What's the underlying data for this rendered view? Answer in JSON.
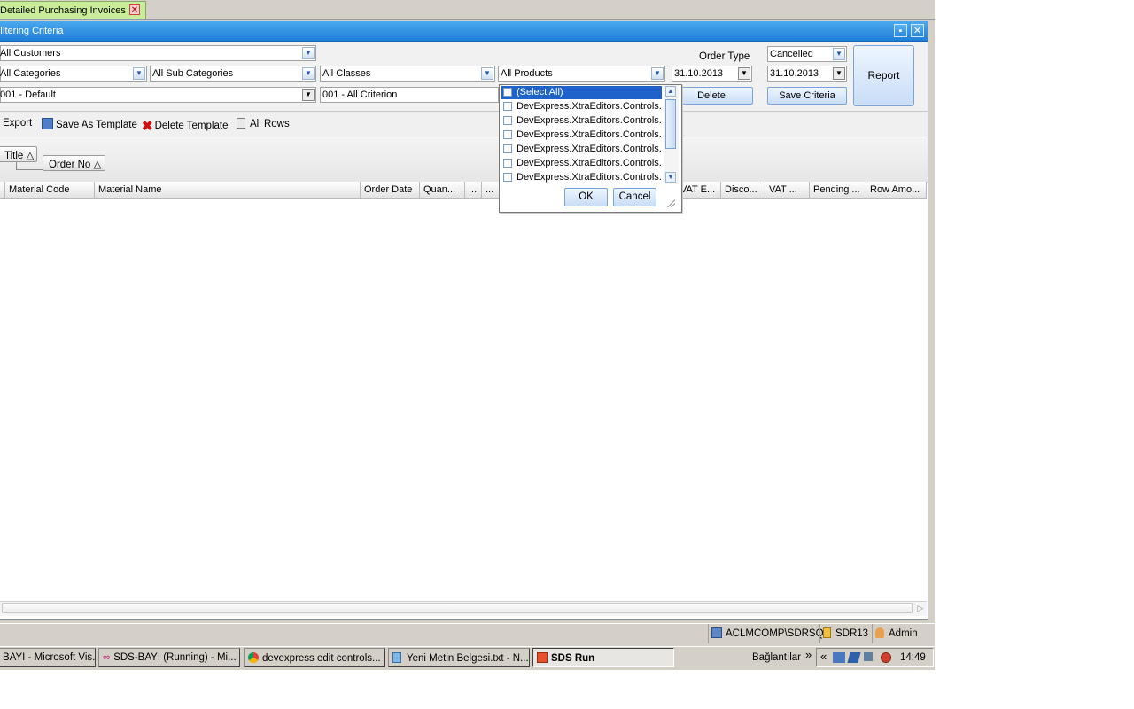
{
  "doc_tab": {
    "label": "Detailed Purchasing Invoices",
    "close": "✕"
  },
  "panel": {
    "title": "Iltering Criteria",
    "pin": "📌",
    "close": "✕"
  },
  "criteria": {
    "customers": "All Customers",
    "categories": "All Categories",
    "sub_categories": "All Sub Categories",
    "classes": "All Classes",
    "products": "All Products",
    "template": "001 - Default",
    "criterion": "001 - All Criterion",
    "order_type_label": "Order Type",
    "order_type_value": "Cancelled",
    "date_from": "31.10.2013",
    "date_to": "31.10.2013",
    "delete_label": "Delete",
    "save_criteria_label": "Save Criteria",
    "report_label": "Report"
  },
  "toolbar": {
    "export": "Export",
    "save_template": "Save As Template",
    "delete_template": "Delete Template",
    "all_rows": "All Rows"
  },
  "group_panel": {
    "chips": [
      "Title △",
      "Order No △"
    ]
  },
  "grid": {
    "columns": [
      "Material Code",
      "Material Name",
      "Order Date",
      "Quan...",
      "...",
      "...",
      "VAT E...",
      "Disco...",
      "VAT ...",
      "Pending ...",
      "Row Amo..."
    ]
  },
  "popup": {
    "items": [
      "(Select All)",
      "DevExpress.XtraEditors.Controls.",
      "DevExpress.XtraEditors.Controls.",
      "DevExpress.XtraEditors.Controls.",
      "DevExpress.XtraEditors.Controls.",
      "DevExpress.XtraEditors.Controls.",
      "DevExpress.XtraEditors.Controls."
    ],
    "ok": "OK",
    "cancel": "Cancel"
  },
  "status": {
    "server": "ACLMCOMP\\SDRSQL",
    "db": "SDR13",
    "user": "Admin"
  },
  "taskbar": {
    "tasks": [
      "BAYI - Microsoft Vis...",
      "SDS-BAYI (Running) - Mi...",
      "devexpress edit controls...",
      "Yeni Metin Belgesi.txt - N...",
      "SDS Run"
    ],
    "links": "Bağlantılar",
    "links_arrow": "»",
    "tray_arrow": "«",
    "clock": "14:49"
  },
  "icons": {
    "combo_arrow": "chevron-down-icon"
  },
  "colors": {
    "title_bar": "#1f7fd8",
    "doc_tab": "#c9ec9a",
    "selection": "#1f62c9"
  }
}
